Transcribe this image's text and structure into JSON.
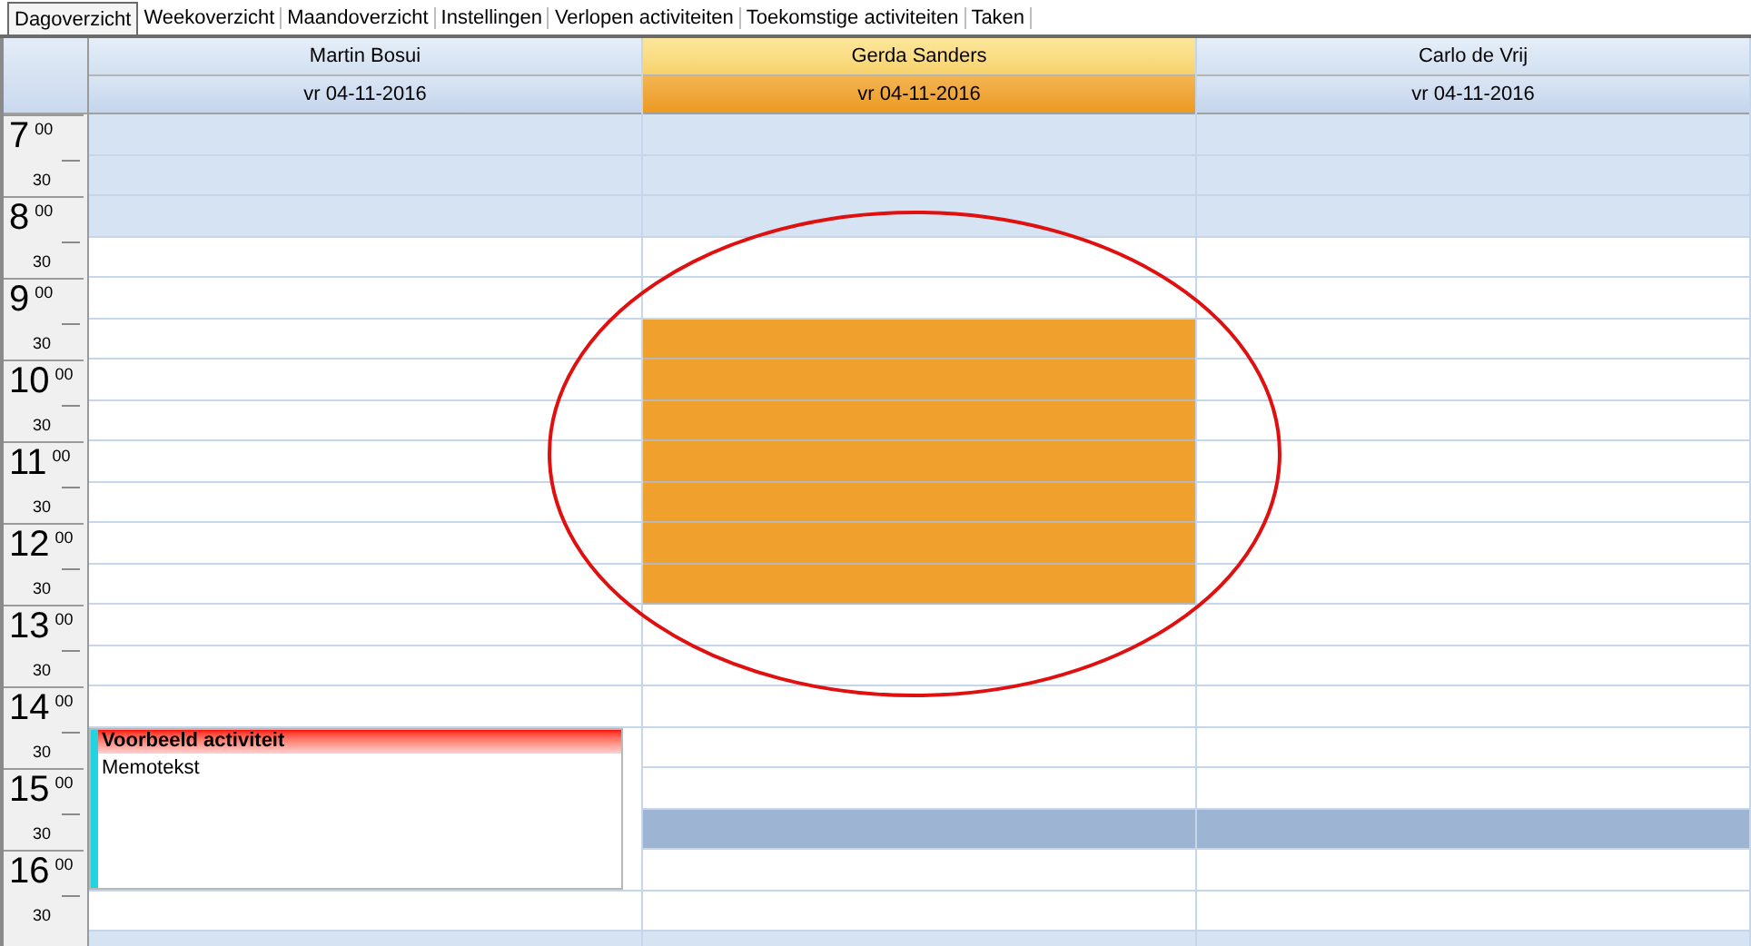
{
  "tabs": [
    {
      "label": "Dagoverzicht",
      "selected": true
    },
    {
      "label": "Weekoverzicht",
      "selected": false
    },
    {
      "label": "Maandoverzicht",
      "selected": false
    },
    {
      "label": "Instellingen",
      "selected": false
    },
    {
      "label": "Verlopen activiteiten",
      "selected": false
    },
    {
      "label": "Toekomstige activiteiten",
      "selected": false
    },
    {
      "label": "Taken",
      "selected": false
    }
  ],
  "resources": [
    {
      "name": "Martin Bosui",
      "date": "vr 04-11-2016",
      "selected": false
    },
    {
      "name": "Gerda Sanders",
      "date": "vr 04-11-2016",
      "selected": true
    },
    {
      "name": "Carlo de Vrij",
      "date": "vr 04-11-2016",
      "selected": false
    }
  ],
  "rows": [
    {
      "hour": "7",
      "minutes": "00",
      "cells": [
        {
          "kind": "off"
        },
        {
          "kind": "off"
        },
        {
          "kind": "off"
        }
      ]
    },
    {
      "half": "30",
      "cells": [
        {
          "kind": "off"
        },
        {
          "kind": "off"
        },
        {
          "kind": "off"
        }
      ]
    },
    {
      "hour": "8",
      "minutes": "00",
      "cells": [
        {
          "kind": "off"
        },
        {
          "kind": "off"
        },
        {
          "kind": "off"
        }
      ]
    },
    {
      "half": "30",
      "cells": [
        {
          "kind": "free"
        },
        {
          "kind": "free"
        },
        {
          "kind": "free"
        }
      ]
    },
    {
      "hour": "9",
      "minutes": "00",
      "cells": [
        {
          "kind": "free"
        },
        {
          "kind": "free"
        },
        {
          "kind": "free"
        }
      ]
    },
    {
      "half": "30",
      "cells": [
        {
          "kind": "free"
        },
        {
          "kind": "busy"
        },
        {
          "kind": "free"
        }
      ]
    },
    {
      "hour": "10",
      "minutes": "00",
      "cells": [
        {
          "kind": "free"
        },
        {
          "kind": "busy"
        },
        {
          "kind": "free"
        }
      ]
    },
    {
      "half": "30",
      "cells": [
        {
          "kind": "free"
        },
        {
          "kind": "busy"
        },
        {
          "kind": "free"
        }
      ]
    },
    {
      "hour": "11",
      "minutes": "00",
      "cells": [
        {
          "kind": "free"
        },
        {
          "kind": "busy"
        },
        {
          "kind": "free"
        }
      ]
    },
    {
      "half": "30",
      "cells": [
        {
          "kind": "free"
        },
        {
          "kind": "busy"
        },
        {
          "kind": "free"
        }
      ]
    },
    {
      "hour": "12",
      "minutes": "00",
      "cells": [
        {
          "kind": "free"
        },
        {
          "kind": "busy"
        },
        {
          "kind": "free"
        }
      ]
    },
    {
      "half": "30",
      "cells": [
        {
          "kind": "free"
        },
        {
          "kind": "busy"
        },
        {
          "kind": "free"
        }
      ]
    },
    {
      "hour": "13",
      "minutes": "00",
      "cells": [
        {
          "kind": "free"
        },
        {
          "kind": "free"
        },
        {
          "kind": "free"
        }
      ]
    },
    {
      "half": "30",
      "cells": [
        {
          "kind": "free"
        },
        {
          "kind": "free"
        },
        {
          "kind": "free"
        }
      ]
    },
    {
      "hour": "14",
      "minutes": "00",
      "cells": [
        {
          "kind": "free"
        },
        {
          "kind": "free"
        },
        {
          "kind": "free"
        }
      ]
    },
    {
      "half": "30",
      "cells": [
        {
          "kind": "event",
          "title": "Voorbeeld activiteit",
          "memo": "Memotekst"
        },
        {
          "kind": "free"
        },
        {
          "kind": "free"
        }
      ]
    },
    {
      "hour": "15",
      "minutes": "00",
      "cells": [
        {
          "kind": "event_cont"
        },
        {
          "kind": "free"
        },
        {
          "kind": "free"
        }
      ]
    },
    {
      "half": "30",
      "cells": [
        {
          "kind": "event_cont"
        },
        {
          "kind": "selected"
        },
        {
          "kind": "selected"
        }
      ]
    },
    {
      "hour": "16",
      "minutes": "00",
      "cells": [
        {
          "kind": "event_cont"
        },
        {
          "kind": "free"
        },
        {
          "kind": "free"
        }
      ]
    },
    {
      "half": "30",
      "cells": [
        {
          "kind": "free"
        },
        {
          "kind": "free"
        },
        {
          "kind": "free"
        }
      ]
    },
    {
      "cells": [
        {
          "kind": "off"
        },
        {
          "kind": "off"
        },
        {
          "kind": "off"
        }
      ]
    }
  ]
}
